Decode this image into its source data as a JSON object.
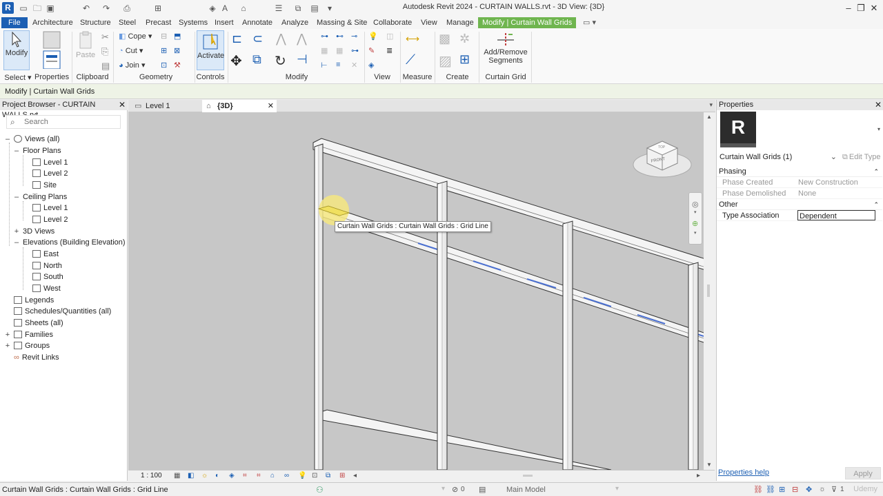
{
  "app": {
    "logo": "R",
    "title": "Autodesk Revit 2024 - CURTAIN WALLS.rvt - 3D View: {3D}"
  },
  "ribbon_tabs": [
    "File",
    "Architecture",
    "Structure",
    "Steel",
    "Precast",
    "Systems",
    "Insert",
    "Annotate",
    "Analyze",
    "Massing & Site",
    "Collaborate",
    "View",
    "Manage",
    "Modify | Curtain Wall Grids"
  ],
  "ribbon": {
    "modify": "Modify",
    "paste": "Paste",
    "cope": "Cope",
    "cut": "Cut",
    "join": "Join",
    "activate": "Activate",
    "add_remove_line1": "Add/Remove",
    "add_remove_line2": "Segments",
    "panels": {
      "select": "Select",
      "properties": "Properties",
      "clipboard": "Clipboard",
      "geometry": "Geometry",
      "controls": "Controls",
      "modify": "Modify",
      "view": "View",
      "measure": "Measure",
      "create": "Create",
      "curtain_grid": "Curtain Grid"
    }
  },
  "options_bar": "Modify | Curtain Wall Grids",
  "project_browser": {
    "title": "Project Browser - CURTAIN WALLS.rvt",
    "search_placeholder": "Search",
    "views_all": "Views (all)",
    "floor_plans": "Floor Plans",
    "fp_level1": "Level 1",
    "fp_level2": "Level 2",
    "fp_site": "Site",
    "ceiling_plans": "Ceiling Plans",
    "cp_level1": "Level 1",
    "cp_level2": "Level 2",
    "views_3d": "3D Views",
    "elevations": "Elevations (Building Elevation)",
    "el_east": "East",
    "el_north": "North",
    "el_south": "South",
    "el_west": "West",
    "legends": "Legends",
    "schedules": "Schedules/Quantities (all)",
    "sheets": "Sheets (all)",
    "families": "Families",
    "groups": "Groups",
    "revit_links": "Revit Links"
  },
  "view_tabs": {
    "level1": "Level 1",
    "threed": "{3D}"
  },
  "viewport": {
    "tooltip": "Curtain Wall Grids : Curtain Wall Grids : Grid Line",
    "scale": "1 : 100",
    "viewcube_face": "FRONT",
    "viewcube_top": "TOP"
  },
  "properties": {
    "title": "Properties",
    "thumb": "R",
    "type_selector": "Curtain Wall Grids (1)",
    "edit_type": "Edit Type",
    "group_phasing": "Phasing",
    "phase_created_label": "Phase Created",
    "phase_created_value": "New Construction",
    "phase_demolished_label": "Phase Demolished",
    "phase_demolished_value": "None",
    "group_other": "Other",
    "type_association_label": "Type Association",
    "type_association_value": "Dependent",
    "help": "Properties help",
    "apply": "Apply"
  },
  "status": {
    "text": "Curtain Wall Grids : Curtain Wall Grids : Grid Line",
    "workset_count": "0",
    "model": "Main Model",
    "filter_count": "1",
    "watermark": "Udemy"
  },
  "colors": {
    "brand": "#1c5fb3",
    "context_tab": "#6fb54f",
    "grid_highlight": "#4a6fd0"
  }
}
